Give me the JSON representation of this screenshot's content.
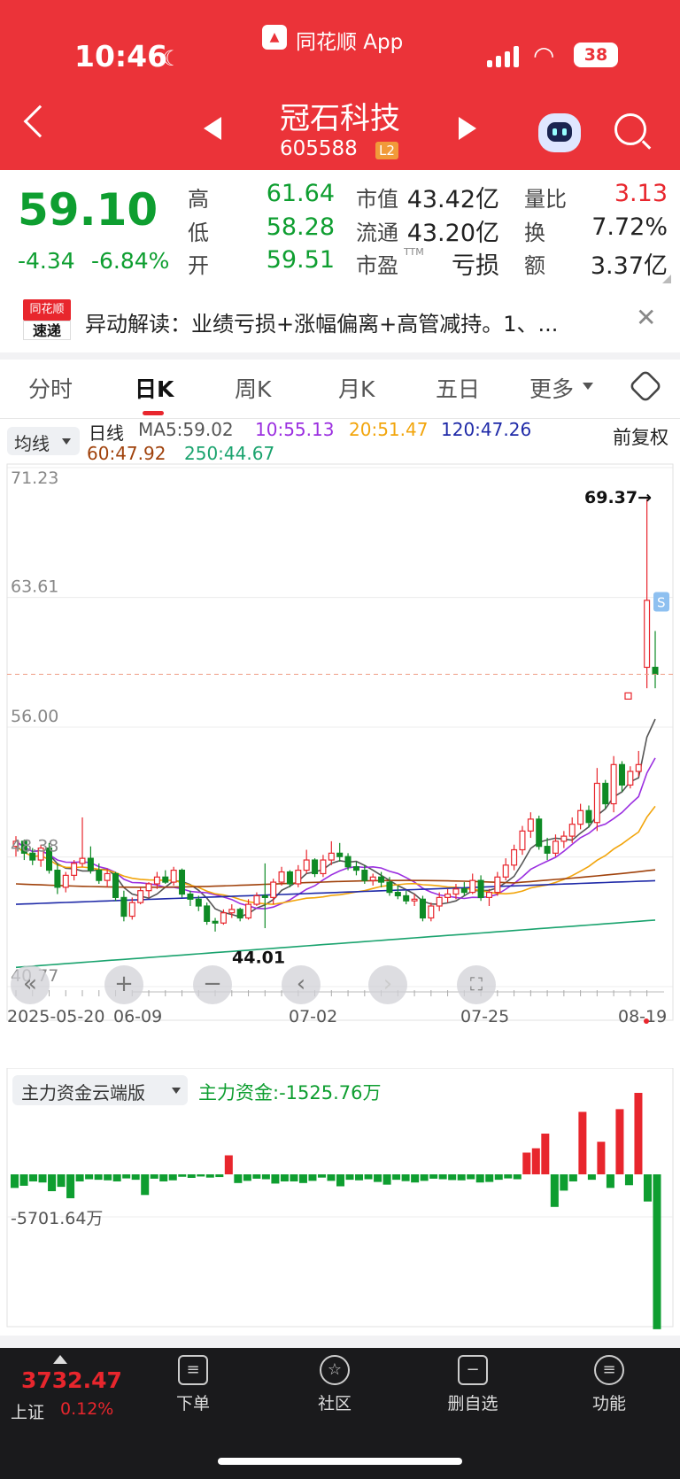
{
  "status": {
    "time": "10:46",
    "app": "同花顺 App",
    "battery": "38"
  },
  "nav": {
    "name": "冠石科技",
    "code": "605588",
    "level": "L2"
  },
  "quote": {
    "price": "59.10",
    "change": "-4.34",
    "pct": "-6.84%",
    "cells": [
      {
        "label": "高",
        "value": "61.64",
        "color": "green"
      },
      {
        "label": "市值",
        "value": "43.42亿",
        "color": "black"
      },
      {
        "label": "量比",
        "value": "3.13",
        "color": "red"
      },
      {
        "label": "低",
        "value": "58.28",
        "color": "green"
      },
      {
        "label": "流通",
        "value": "43.20亿",
        "color": "black"
      },
      {
        "label": "换",
        "value": "7.72%",
        "color": "black"
      },
      {
        "label": "开",
        "value": "59.51",
        "color": "green"
      },
      {
        "label": "市盈",
        "value": "亏损",
        "color": "black",
        "sup": "TTM"
      },
      {
        "label": "额",
        "value": "3.37亿",
        "color": "black"
      }
    ]
  },
  "news": {
    "badge1": "同花顺",
    "badge2": "速递",
    "text": "异动解读：业绩亏损+涨幅偏离+高管减持。1、..."
  },
  "tabs": [
    "分时",
    "日K",
    "周K",
    "月K",
    "五日",
    "更多"
  ],
  "active_tab": "日K",
  "ma": {
    "chip": "均线",
    "items": [
      {
        "text": "日线",
        "color": "#222"
      },
      {
        "text": "MA5:59.02",
        "color": "#555"
      },
      {
        "text": "10:55.13",
        "color": "#9b2fe0"
      },
      {
        "text": "20:51.47",
        "color": "#f2a50c"
      },
      {
        "text": "120:47.26",
        "color": "#1f2aa8"
      },
      {
        "text": "60:47.92",
        "color": "#a0420c"
      },
      {
        "text": "250:44.67",
        "color": "#1aa36e"
      }
    ],
    "adjust": "前复权"
  },
  "axis": {
    "y_labels": [
      "71.23",
      "63.61",
      "56.00",
      "48.38",
      "40.77"
    ],
    "high_marker": "69.37→",
    "low_marker": "44.01",
    "s_tag": "S",
    "x_labels": [
      "2025-05-20",
      "06-09",
      "07-02",
      "07-25",
      "08-19"
    ]
  },
  "fund": {
    "chip": "主力资金云端版",
    "label": "主力资金:-1525.76万",
    "ref": "-5701.64万"
  },
  "bottom": {
    "index_value": "3732.47",
    "index_name": "上证",
    "index_pct": "0.12%",
    "tabs": [
      "下单",
      "社区",
      "删自选",
      "功能"
    ]
  },
  "chart_data": [
    {
      "type": "candlestick",
      "title": "日K",
      "ylim": [
        40.77,
        71.23
      ],
      "y_ticks": [
        71.23,
        63.61,
        56.0,
        48.38,
        40.77
      ],
      "x_ticks": [
        "2025-05-20",
        "06-09",
        "07-02",
        "07-25",
        "08-19"
      ],
      "candles": [
        [
          49.0,
          49.6,
          48.4,
          49.3
        ],
        [
          49.3,
          49.4,
          48.2,
          48.6
        ],
        [
          48.6,
          48.9,
          47.9,
          48.2
        ],
        [
          48.2,
          49.1,
          47.8,
          48.9
        ],
        [
          48.9,
          49.2,
          47.4,
          47.6
        ],
        [
          47.6,
          48.0,
          46.2,
          46.6
        ],
        [
          46.6,
          47.5,
          46.3,
          47.3
        ],
        [
          47.3,
          48.2,
          47.0,
          48.0
        ],
        [
          48.0,
          50.7,
          47.8,
          48.3
        ],
        [
          48.3,
          49.0,
          47.4,
          47.6
        ],
        [
          47.6,
          48.0,
          46.8,
          47.0
        ],
        [
          47.0,
          47.7,
          46.6,
          47.4
        ],
        [
          47.4,
          47.5,
          45.8,
          46.0
        ],
        [
          46.0,
          46.4,
          44.6,
          44.9
        ],
        [
          44.9,
          46.0,
          44.7,
          45.7
        ],
        [
          45.7,
          46.6,
          45.6,
          46.4
        ],
        [
          46.4,
          46.9,
          46.0,
          46.8
        ],
        [
          46.8,
          47.5,
          46.5,
          47.2
        ],
        [
          47.2,
          47.6,
          46.8,
          46.9
        ],
        [
          46.9,
          47.8,
          46.7,
          47.6
        ],
        [
          47.6,
          47.7,
          46.0,
          46.2
        ],
        [
          46.2,
          46.4,
          45.5,
          45.9
        ],
        [
          45.9,
          46.1,
          45.2,
          45.5
        ],
        [
          45.5,
          45.7,
          44.4,
          44.6
        ],
        [
          44.6,
          44.8,
          44.0,
          44.5
        ],
        [
          44.5,
          45.3,
          44.4,
          45.1
        ],
        [
          45.1,
          45.6,
          44.8,
          45.3
        ],
        [
          45.3,
          45.4,
          44.6,
          44.8
        ],
        [
          44.8,
          45.9,
          44.7,
          45.6
        ],
        [
          45.6,
          46.3,
          45.5,
          46.1
        ],
        [
          46.1,
          48.0,
          44.2,
          46.0
        ],
        [
          46.0,
          47.1,
          45.6,
          46.9
        ],
        [
          46.9,
          47.8,
          46.7,
          47.5
        ],
        [
          47.5,
          47.6,
          46.6,
          46.8
        ],
        [
          46.8,
          47.9,
          46.6,
          47.6
        ],
        [
          47.6,
          48.8,
          47.4,
          48.2
        ],
        [
          48.2,
          48.3,
          47.2,
          47.4
        ],
        [
          47.4,
          48.5,
          47.2,
          48.2
        ],
        [
          48.2,
          49.3,
          47.9,
          48.6
        ],
        [
          48.6,
          49.2,
          48.1,
          48.4
        ],
        [
          48.4,
          48.6,
          47.6,
          47.8
        ],
        [
          47.8,
          48.1,
          47.3,
          47.6
        ],
        [
          47.6,
          47.9,
          46.8,
          47.0
        ],
        [
          47.0,
          47.4,
          46.7,
          47.2
        ],
        [
          47.2,
          47.5,
          46.6,
          46.9
        ],
        [
          46.9,
          47.2,
          46.1,
          46.3
        ],
        [
          46.3,
          46.7,
          45.9,
          46.1
        ],
        [
          46.1,
          46.4,
          45.6,
          45.8
        ],
        [
          45.8,
          46.2,
          45.5,
          45.9
        ],
        [
          45.9,
          46.1,
          44.6,
          44.8
        ],
        [
          44.8,
          45.7,
          44.6,
          45.5
        ],
        [
          45.5,
          46.3,
          45.2,
          46.0
        ],
        [
          46.0,
          46.5,
          45.7,
          46.2
        ],
        [
          46.2,
          46.8,
          45.9,
          46.5
        ],
        [
          46.5,
          46.9,
          46.1,
          46.3
        ],
        [
          46.3,
          47.4,
          46.2,
          47.0
        ],
        [
          47.0,
          47.3,
          45.8,
          46.0
        ],
        [
          46.0,
          46.5,
          45.5,
          46.3
        ],
        [
          46.3,
          47.5,
          46.1,
          47.2
        ],
        [
          47.2,
          48.3,
          47.0,
          47.9
        ],
        [
          47.9,
          49.1,
          47.6,
          48.8
        ],
        [
          48.8,
          50.2,
          48.5,
          49.9
        ],
        [
          49.9,
          51.0,
          49.5,
          50.6
        ],
        [
          50.6,
          50.8,
          48.8,
          49.0
        ],
        [
          49.0,
          49.5,
          48.2,
          48.6
        ],
        [
          48.6,
          49.7,
          48.4,
          49.3
        ],
        [
          49.3,
          49.9,
          48.9,
          49.6
        ],
        [
          49.6,
          50.7,
          49.2,
          50.3
        ],
        [
          50.3,
          51.5,
          50.0,
          51.1
        ],
        [
          51.1,
          51.4,
          50.1,
          50.4
        ],
        [
          50.4,
          53.6,
          49.9,
          52.7
        ],
        [
          52.7,
          52.9,
          51.2,
          51.5
        ],
        [
          51.5,
          54.3,
          51.0,
          53.8
        ],
        [
          53.8,
          54.0,
          52.2,
          52.6
        ],
        [
          52.6,
          53.7,
          52.4,
          53.4
        ],
        [
          53.4,
          54.6,
          53.1,
          53.8
        ],
        [
          59.51,
          69.37,
          58.28,
          63.44
        ],
        [
          59.51,
          61.64,
          58.28,
          59.1
        ]
      ],
      "series": [
        {
          "name": "MA5",
          "last": 59.02
        },
        {
          "name": "10",
          "last": 55.13
        },
        {
          "name": "20",
          "last": 51.47
        },
        {
          "name": "120",
          "last": 47.26
        },
        {
          "name": "60",
          "last": 47.92
        },
        {
          "name": "250",
          "last": 44.67
        }
      ]
    },
    {
      "type": "bar",
      "title": "主力资金云端版",
      "ylabel": "万",
      "values": [
        -500,
        -420,
        -260,
        -300,
        -620,
        -460,
        -880,
        -260,
        -180,
        -200,
        -220,
        -260,
        -150,
        -200,
        -760,
        -160,
        -260,
        -220,
        -90,
        -130,
        -80,
        -120,
        -100,
        700,
        -320,
        -240,
        -160,
        -180,
        -340,
        -260,
        -260,
        -320,
        -240,
        -120,
        -240,
        -440,
        -200,
        -220,
        -180,
        -280,
        -380,
        -200,
        -250,
        -300,
        -240,
        -160,
        -180,
        -210,
        -220,
        -180,
        -300,
        -280,
        -200,
        -150,
        -180,
        800,
        960,
        1500,
        -1200,
        -600,
        -260,
        2300,
        -200,
        1200,
        -500,
        2400,
        -400,
        3000,
        -1000,
        -5701.64
      ]
    }
  ]
}
